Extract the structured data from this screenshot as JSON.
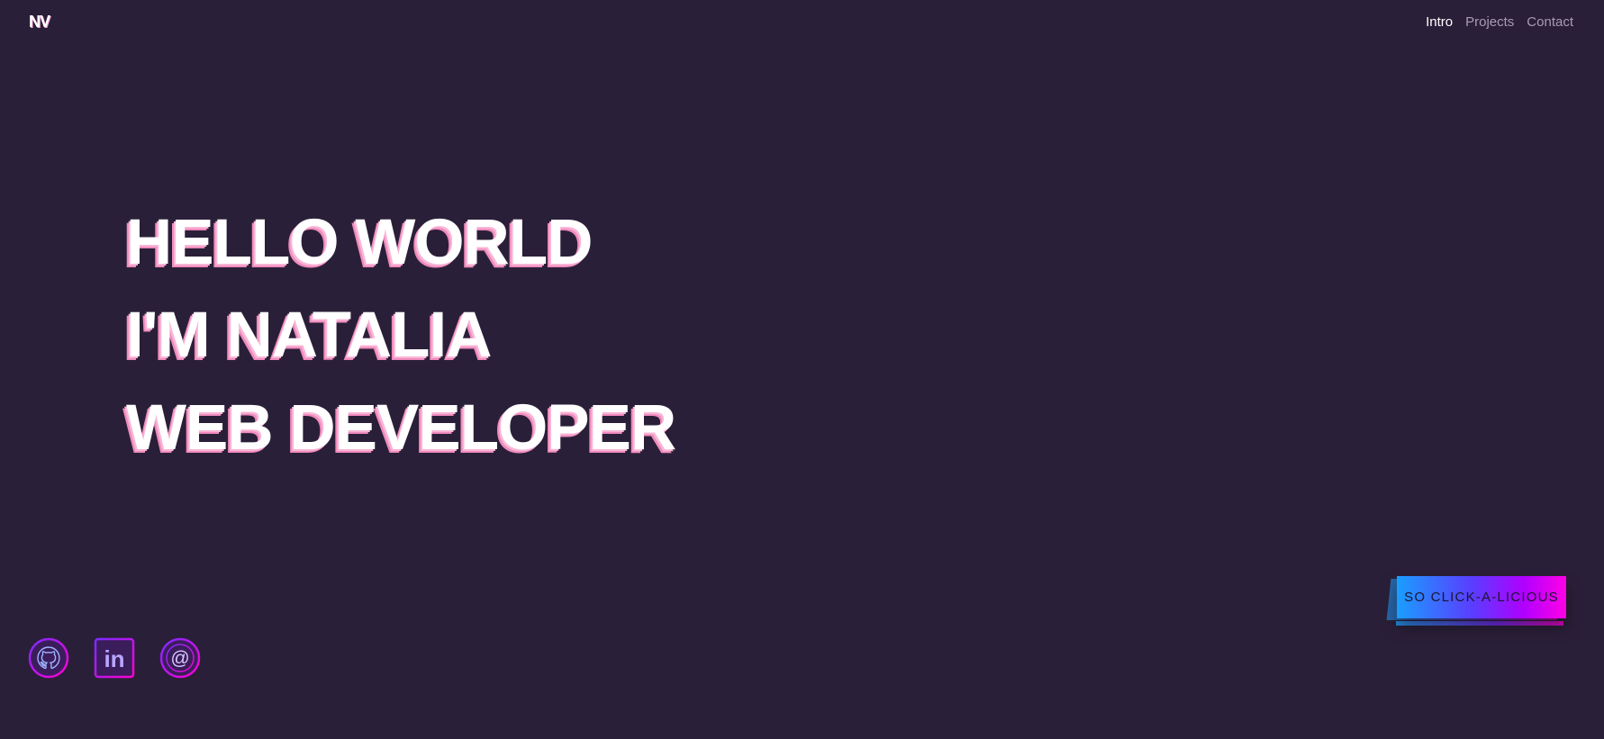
{
  "logo": {
    "text": "NV"
  },
  "nav": {
    "items": [
      {
        "label": "Intro",
        "active": true
      },
      {
        "label": "Projects",
        "active": false
      },
      {
        "label": "Contact",
        "active": false
      }
    ]
  },
  "hero": {
    "lines": [
      "HELLO WORLD",
      "I'M NATALIA",
      "WEB DEVELOPER"
    ]
  },
  "socials": [
    {
      "icon": "github-icon"
    },
    {
      "icon": "linkedin-icon"
    },
    {
      "icon": "at-sign-icon"
    }
  ],
  "cta": {
    "label": "SO CLICK-A-LICIOUS"
  },
  "colors": {
    "background": "#2a1f38",
    "text_shadow_pink": "#f9b6d6",
    "gradient_start": "#1a9eff",
    "gradient_end": "#ff00e6",
    "icon_gradient_start": "#7a2cff",
    "icon_gradient_end": "#ff00d4"
  }
}
